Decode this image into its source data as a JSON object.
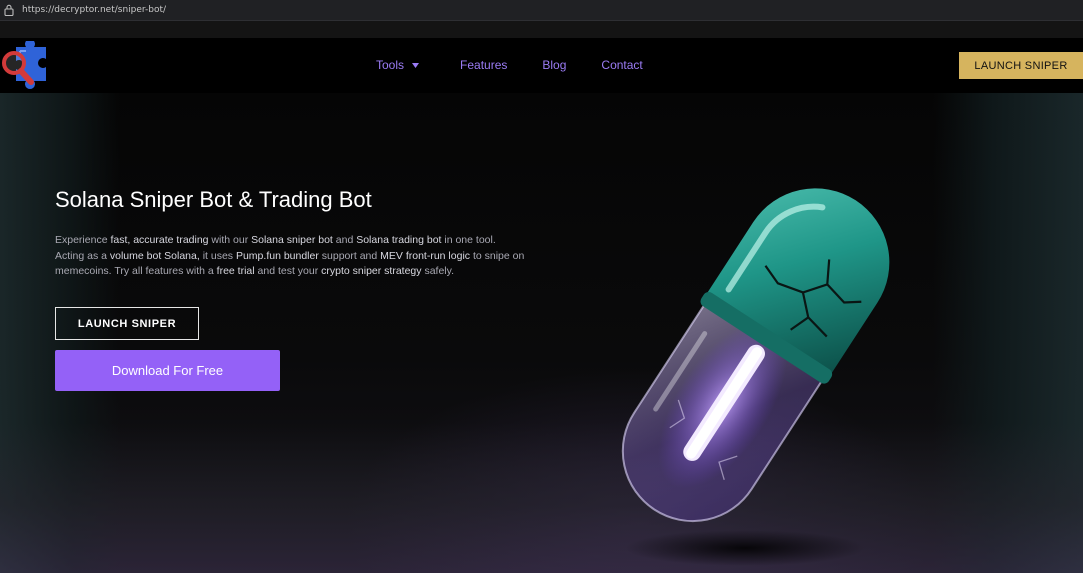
{
  "browser": {
    "url": "https://decryptor.net/sniper-bot/"
  },
  "nav": {
    "links": [
      {
        "label": "Tools"
      },
      {
        "label": "Features"
      },
      {
        "label": "Blog"
      },
      {
        "label": "Contact"
      }
    ],
    "cta": "LAUNCH SNIPER"
  },
  "hero": {
    "title": "Solana Sniper Bot & Trading Bot",
    "description": {
      "p1": "Experience ",
      "b1": "fast, accurate trading",
      "p2": " with our ",
      "b2": "Solana sniper bot",
      "p3": " and ",
      "b3": "Solana trading bot",
      "p4": " in one tool. Acting as a ",
      "b4": "volume bot Solana,",
      "p5": " it uses ",
      "b5": "Pump.fun bundler",
      "p6": " support and ",
      "b6": "MEV front-run logic",
      "p7": " to snipe on memecoins. Try all features with a ",
      "b7": "free trial",
      "p8": " and test your ",
      "b8": "crypto sniper strategy",
      "p9": " safely."
    },
    "launch_button": "LAUNCH SNIPER",
    "download_button": "Download For Free"
  },
  "icons": {
    "logo": "puzzle-magnifier-logo-icon",
    "lock": "lock-icon",
    "caret": "caret-down-icon",
    "hero_image": "glowing-pill-capsule"
  },
  "colors": {
    "accent_purple": "#9461f7",
    "nav_link": "#9b7cf5",
    "cta_gold": "#d6b45e",
    "pill_teal": "#1f9688"
  }
}
